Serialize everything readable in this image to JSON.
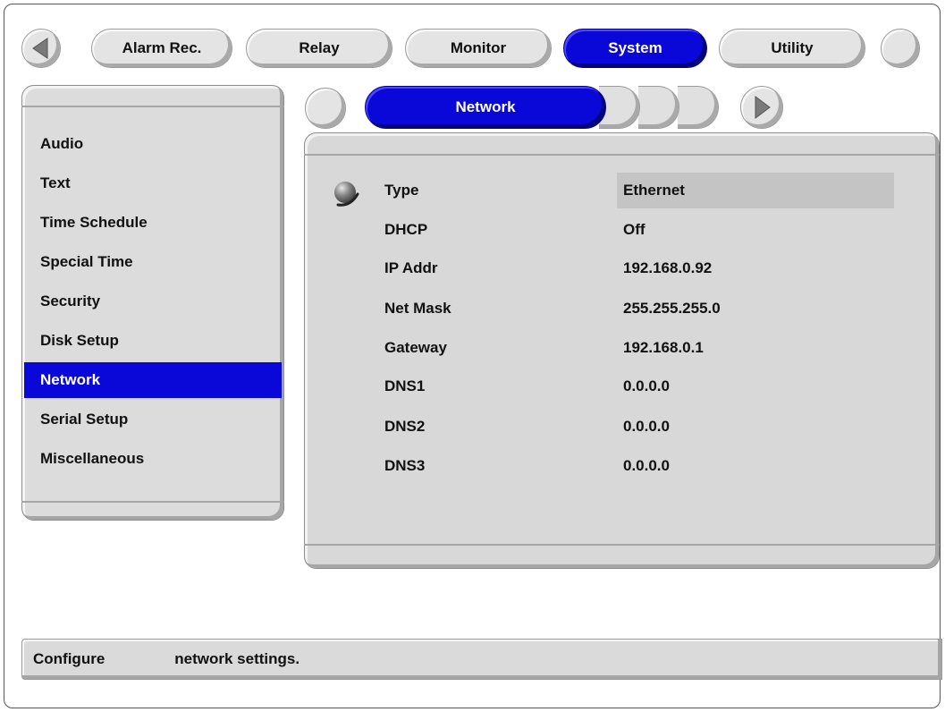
{
  "top_tabs": [
    {
      "label": "Alarm Rec."
    },
    {
      "label": "Relay"
    },
    {
      "label": "Monitor"
    },
    {
      "label": "System"
    },
    {
      "label": "Utility"
    }
  ],
  "active_top_tab": "System",
  "sidebar": {
    "items": [
      {
        "label": "Audio"
      },
      {
        "label": "Text"
      },
      {
        "label": "Time Schedule"
      },
      {
        "label": "Special Time"
      },
      {
        "label": "Security"
      },
      {
        "label": "Disk Setup"
      },
      {
        "label": "Network"
      },
      {
        "label": "Serial Setup"
      },
      {
        "label": "Miscellaneous"
      }
    ],
    "active": "Network"
  },
  "sub_tab": {
    "label": "Network"
  },
  "fields": [
    {
      "label": "Type",
      "value": "Ethernet"
    },
    {
      "label": "DHCP",
      "value": "Off"
    },
    {
      "label": "IP Addr",
      "value": "192.168.0.92"
    },
    {
      "label": "Net Mask",
      "value": "255.255.255.0"
    },
    {
      "label": "Gateway",
      "value": "192.168.0.1"
    },
    {
      "label": "DNS1",
      "value": "0.0.0.0"
    },
    {
      "label": "DNS2",
      "value": "0.0.0.0"
    },
    {
      "label": "DNS3",
      "value": "0.0.0.0"
    }
  ],
  "status": {
    "part1": "Configure",
    "part2": "network settings."
  },
  "colors": {
    "accent": "#0a08d8",
    "panel": "#dcdcdc",
    "selected_value_bg": "#c4c4c4"
  },
  "icons": [
    "left-arrow-icon",
    "right-arrow-icon",
    "cursor-ball-icon"
  ]
}
